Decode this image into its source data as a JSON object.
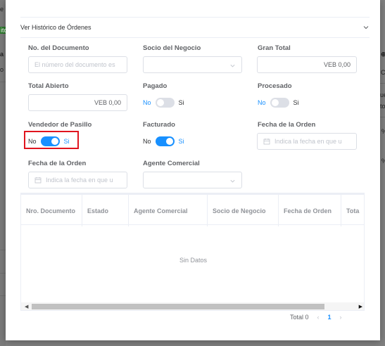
{
  "background_fragments": {
    "f1": "e",
    "f2": "ito",
    "f3": "a",
    "f4": "o",
    "f5": "C",
    "f6": "ue",
    "f7": "to",
    "f8": "%",
    "f9": "%"
  },
  "dialog": {
    "collapse_title": "Ver Histórico de Órdenes"
  },
  "form": {
    "doc_number": {
      "label": "No. del Documento",
      "placeholder": "El número del documento es"
    },
    "business_partner": {
      "label": "Socio del Negocio"
    },
    "grand_total": {
      "label": "Gran Total",
      "value": "VEB 0,00"
    },
    "open_total": {
      "label": "Total Abierto",
      "value": "VEB 0,00"
    },
    "paid": {
      "label": "Pagado",
      "off": "No",
      "on": "Si",
      "checked": false
    },
    "processed": {
      "label": "Procesado",
      "off": "No",
      "on": "Si",
      "checked": false
    },
    "aisle_seller": {
      "label": "Vendedor de Pasillo",
      "off": "No",
      "on": "Si",
      "checked": true
    },
    "invoiced": {
      "label": "Facturado",
      "off": "No",
      "on": "Si",
      "checked": true
    },
    "order_date_from": {
      "label": "Fecha de la Orden",
      "placeholder": "Indica la fecha en que u"
    },
    "order_date_to": {
      "label": "Fecha de la Orden",
      "placeholder": "Indica la fecha en que u"
    },
    "sales_agent": {
      "label": "Agente Comercial"
    }
  },
  "table": {
    "columns": [
      "Nro. Documento",
      "Estado",
      "Agente Comercial",
      "Socio de Negocio",
      "Fecha de Orden",
      "Tota"
    ],
    "empty_text": "Sin Datos"
  },
  "pagination": {
    "total": "Total 0",
    "current_page": "1"
  },
  "colors": {
    "accent": "#1890ff",
    "highlight": "#e0141e"
  }
}
